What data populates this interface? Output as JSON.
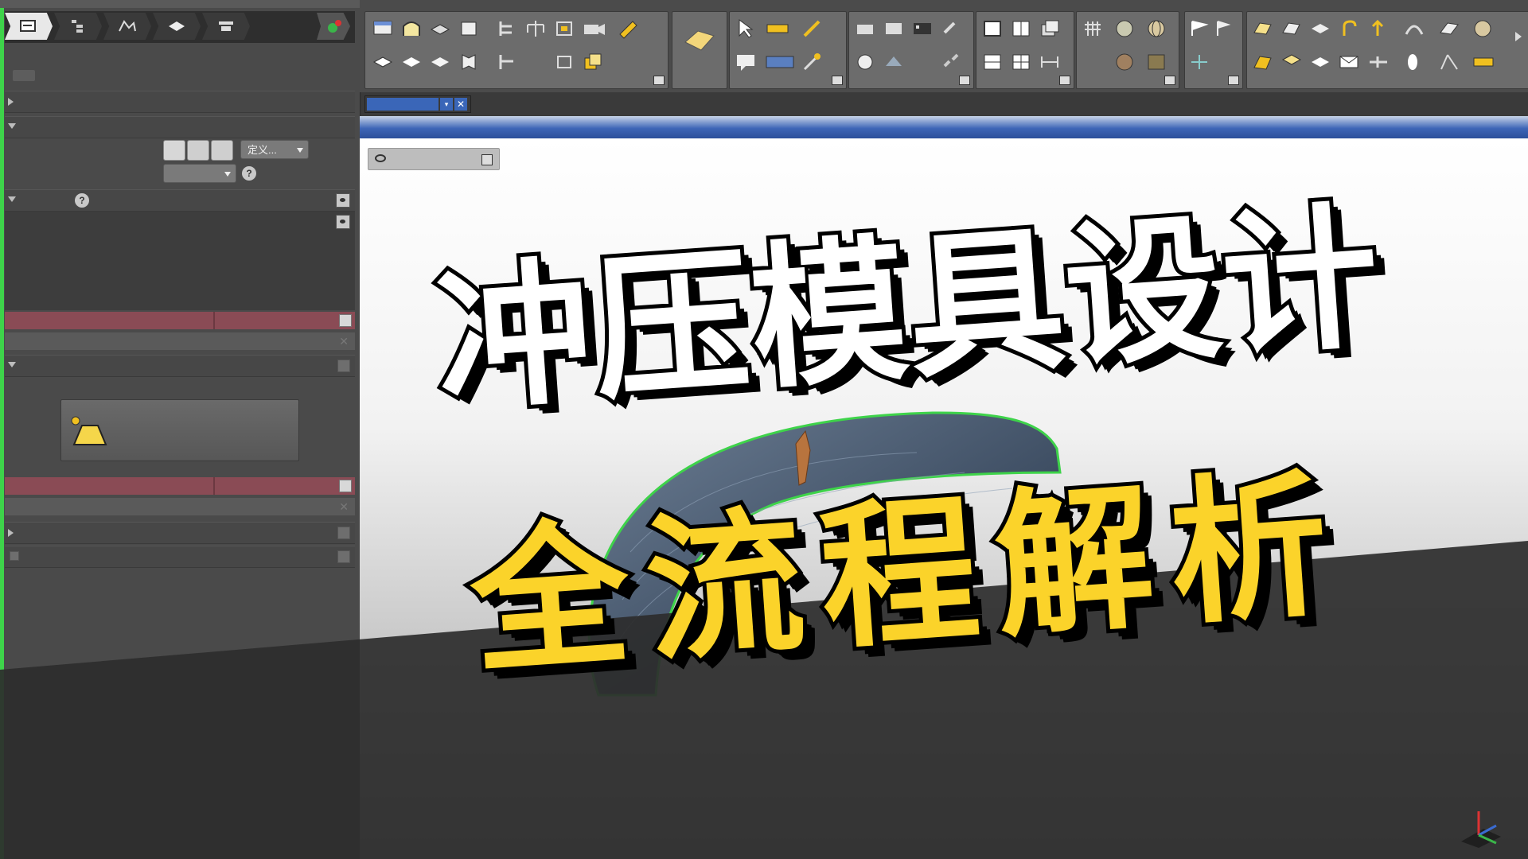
{
  "left_panel": {
    "custom_dropdown": "定义...",
    "help_glyph": "?",
    "close_glyph": "✕"
  },
  "document_tab": {
    "close_glyph": "✕",
    "menu_glyph": "▾"
  },
  "headline": {
    "line1": "冲压模具设计",
    "line2": "全流程解析"
  },
  "colors": {
    "headline_line1": "#ffffff",
    "headline_line2": "#fbd32a",
    "outline": "#000000",
    "selection_highlight": "#3ed34a",
    "title_bar": "#3e66b7",
    "accent_red_row": "#8a4b55"
  }
}
